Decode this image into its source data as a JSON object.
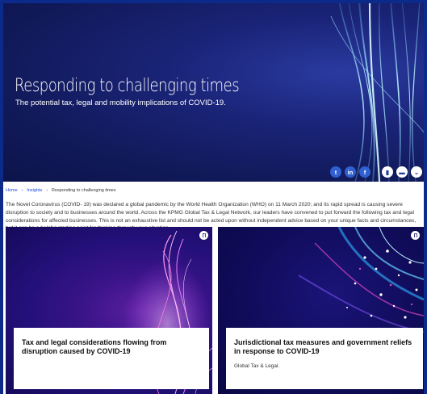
{
  "hero": {
    "title": "Responding to challenging times",
    "subtitle": "The potential tax, legal and mobility implications of COVID-19.",
    "share": [
      {
        "icon": "twitter-icon",
        "glyph": "t"
      },
      {
        "icon": "linkedin-icon",
        "glyph": "in"
      },
      {
        "icon": "facebook-icon",
        "glyph": "f"
      }
    ],
    "tools": [
      {
        "icon": "bookmark-icon",
        "glyph": "▮"
      },
      {
        "icon": "print-icon",
        "glyph": "▬"
      },
      {
        "icon": "chevron-down-icon",
        "glyph": "⌄"
      }
    ]
  },
  "breadcrumb": {
    "home": "Home",
    "insights": "Insights",
    "current": "Responding to challenging times",
    "separator": "›"
  },
  "intro": "The Novel Coronavirus (COVID- 19) was declared a global pandemic by the World Health Organization (WHO) on 11 March 2020; and its rapid spread is causing severe disruption to society and to businesses around the world. Across the KPMG Global Tax & Legal Network, our leaders have convened to put forward the following tax and legal considerations for affected businesses. This is not an exhaustive list and should not be acted upon without independent advice based on your unique facts and circumstances, but it can be a helpful starting point for thinking through your situation.",
  "cards": [
    {
      "title": "Tax and legal considerations flowing from disruption caused by COVID-19",
      "tag": ""
    },
    {
      "title": "Jurisdictional tax measures and government reliefs in response to COVID-19",
      "tag": "Global Tax & Legal."
    }
  ],
  "colors": {
    "hero_bg": "#111a5a",
    "link": "#1e49e2",
    "frame": "#0b2a8a",
    "share_button": "#2f5fd0"
  }
}
